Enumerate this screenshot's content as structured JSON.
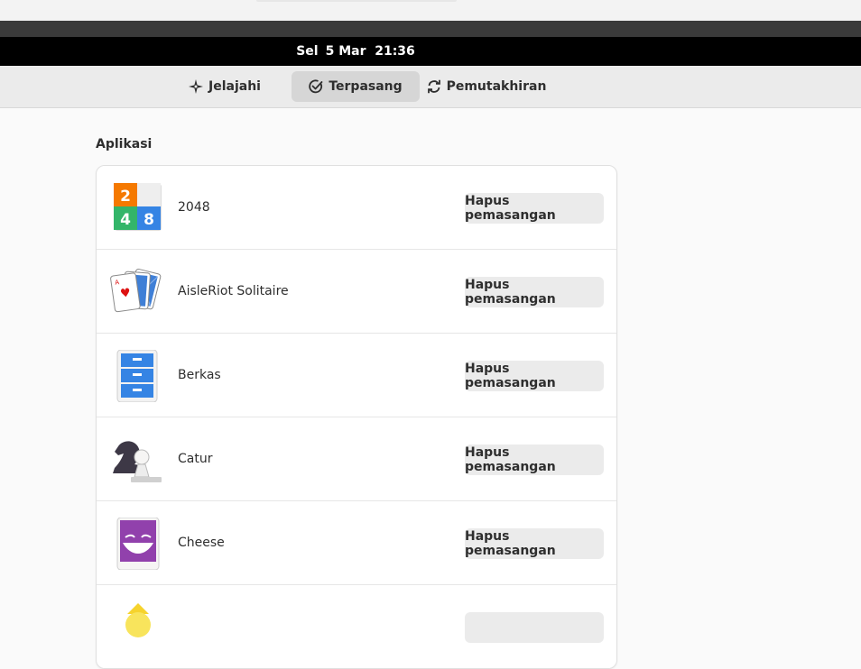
{
  "topbar": {
    "day": "Sel",
    "datetime": "5 Mar  21:36"
  },
  "tabs": [
    {
      "label": "Jelajahi",
      "icon": "explore-icon",
      "active": false
    },
    {
      "label": "Terpasang",
      "icon": "check-circle-icon",
      "active": true
    },
    {
      "label": "Pemutakhiran",
      "icon": "refresh-icon",
      "active": false
    }
  ],
  "section": {
    "title": "Aplikasi"
  },
  "apps": [
    {
      "name": "2048",
      "icon": "2048-icon",
      "button": "Hapus pemasangan"
    },
    {
      "name": "AisleRiot Solitaire",
      "icon": "cards-icon",
      "button": "Hapus pemasangan"
    },
    {
      "name": "Berkas",
      "icon": "file-cabinet-icon",
      "button": "Hapus pemasangan"
    },
    {
      "name": "Catur",
      "icon": "chess-icon",
      "button": "Hapus pemasangan"
    },
    {
      "name": "Cheese",
      "icon": "cheese-icon",
      "button": "Hapus pemasangan"
    },
    {
      "name": "",
      "icon": "sun-icon",
      "button": ""
    }
  ],
  "colors": {
    "topbar": "#000000",
    "header": "#ebebeb",
    "active_tab": "#d6d6d6",
    "button": "#ebebeb",
    "tile_orange": "#f57900",
    "tile_green": "#33b569",
    "tile_blue": "#3584e4",
    "cheese_purple": "#9141ac"
  }
}
